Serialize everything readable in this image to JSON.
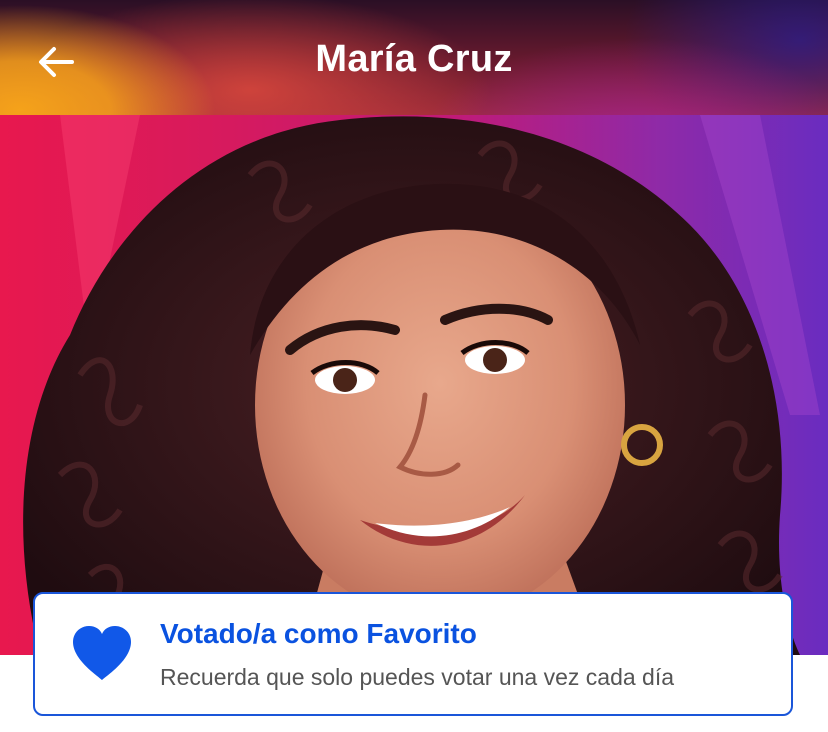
{
  "header": {
    "title": "María Cruz",
    "back_icon": "arrow-left-icon"
  },
  "photo": {
    "subject": "contestant-portrait"
  },
  "vote_card": {
    "icon": "heart-icon",
    "title": "Votado/a como Favorito",
    "subtitle": "Recuerda que solo puedes votar una vez cada día",
    "accent_color": "#0a52e0",
    "border_color": "#1a56d9"
  }
}
